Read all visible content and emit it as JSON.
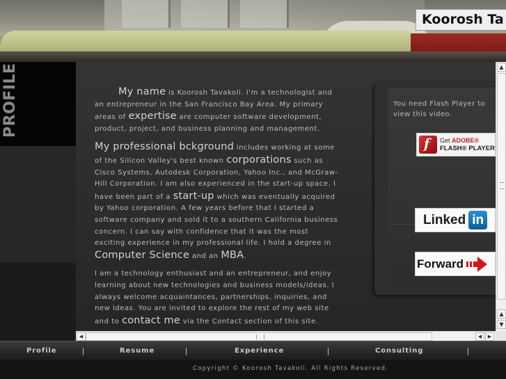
{
  "header": {
    "owner_name": "Koorosh Ta"
  },
  "section_tab": {
    "label": "PROFILE"
  },
  "content": {
    "p1": {
      "lead": "My name",
      "t1": " is Koorosh Tavakoli. I'm a technologist and an entrepreneur in the San Francisco Bay Area. My primary areas of ",
      "hl1": "expertise",
      "t2": " are computer software development, product, project, and business planning and management."
    },
    "p2": {
      "lead": "My professional bckground",
      "t1": " includes working at some of the Silicon Valley's best known ",
      "hl1": "corporations",
      "t2": " such as Cisco Systems, Autodesk Corporation, Yahoo Inc., and McGraw-Hill Corporation. I am also experienced in the start-up space. I have been part of a ",
      "hl2": "start-up",
      "t3": " which was eventually acquired by Yahoo corporation. A few years before that I started a software company and sold it to a southern California business concern. I can say with confidence that it was the most exciting experience in my professional life. I hold a degree in ",
      "hl3": "Computer Science",
      "t4": " and an ",
      "hl4": "MBA",
      "t5": "."
    },
    "p3": {
      "t1": "I am a technology enthusiast and an entrepreneur, and enjoy learning about new technologies and business models/ideas. I always welcome acquaintances, partnerships, inquiries, and new ideas. You are invited to explore the rest of my web site and to ",
      "hl1": "contact me",
      "t2": " via the Contact section of this site."
    }
  },
  "sidebar": {
    "flash_message": "You need Flash Player to view this video.",
    "flash_button": {
      "line1_prefix": "Get",
      "line1_brand": "ADOBE®",
      "line2": "FLASH® PLAYER",
      "icon_letter": "f"
    },
    "linkedin": {
      "label": "Linked",
      "badge": "in"
    },
    "forward": {
      "label": "Forward"
    }
  },
  "nav": {
    "items": [
      "Profile",
      "Resume",
      "Experience",
      "Consulting"
    ]
  },
  "footer": {
    "copyright": "Copyright © Koorosh Tavakoli. All Rights Reserved."
  },
  "scrollbar": {
    "up": "▲",
    "down": "▼",
    "left": "◀",
    "right": "▶"
  },
  "colors": {
    "background": "#1a1a1a",
    "panel": "#2a2a2a",
    "text": "#bcbcbc",
    "accent_red": "#d01a1a",
    "linkedin_blue": "#0b5d99"
  }
}
